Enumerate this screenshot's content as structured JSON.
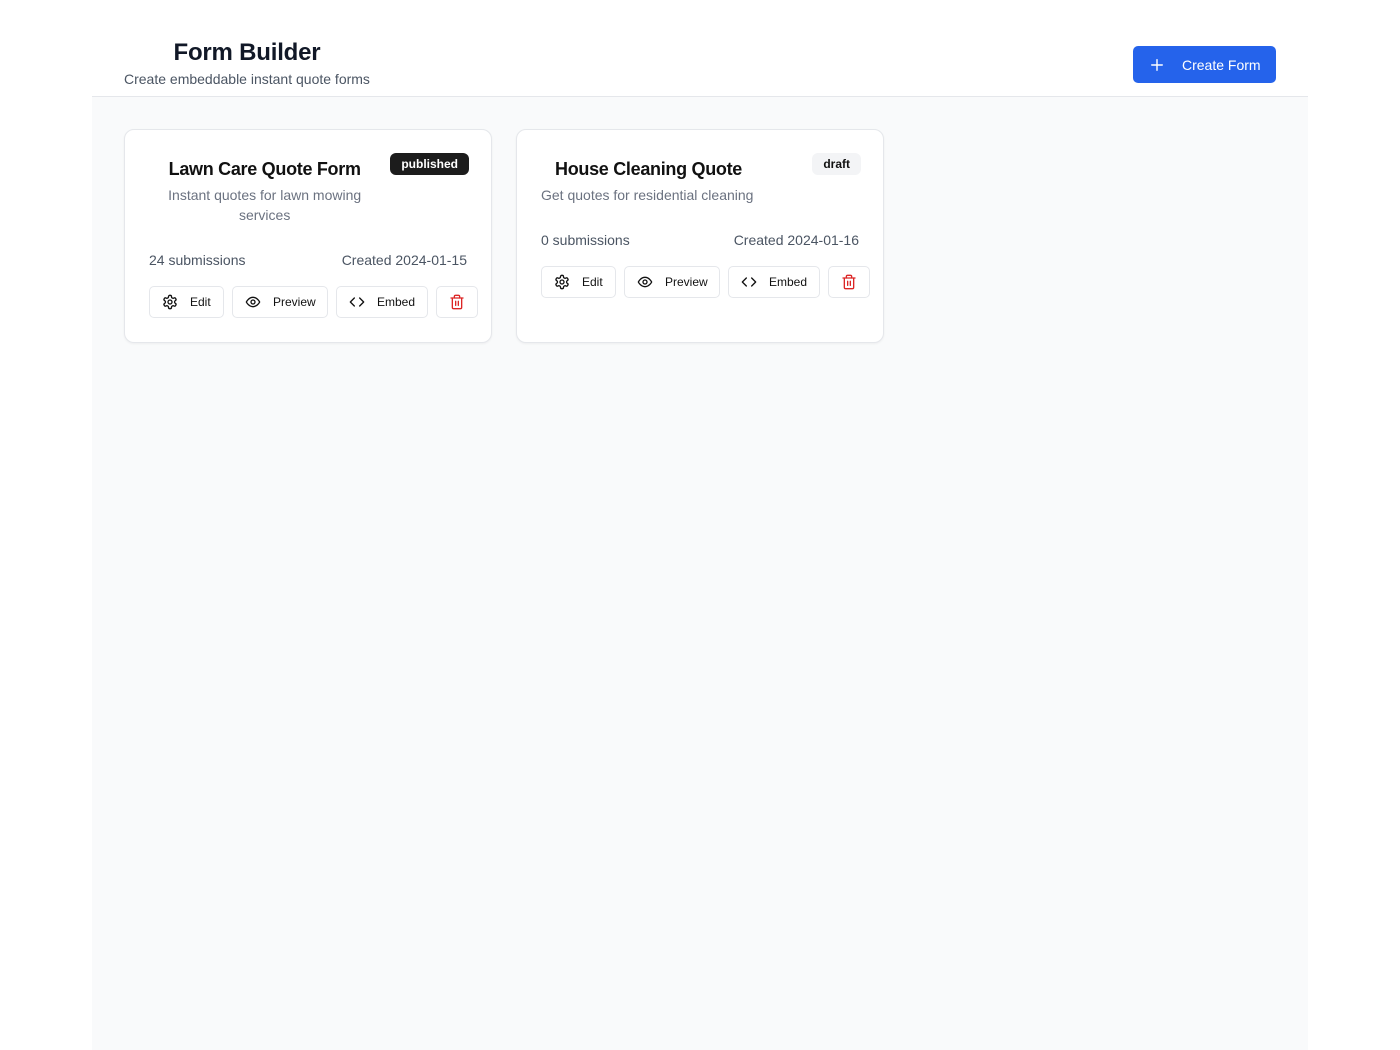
{
  "header": {
    "title": "Form Builder",
    "subtitle": "Create embeddable instant quote forms",
    "create_button_label": "Create Form"
  },
  "forms": [
    {
      "title": "Lawn Care Quote Form",
      "description": "Instant quotes for lawn mowing services",
      "status": "published",
      "submissions": "24 submissions",
      "created": "Created 2024-01-15"
    },
    {
      "title": "House Cleaning Quote",
      "description": "Get quotes for residential cleaning",
      "status": "draft",
      "submissions": "0 submissions",
      "created": "Created 2024-01-16"
    }
  ],
  "actions": {
    "edit_label": "Edit",
    "preview_label": "Preview",
    "embed_label": "Embed"
  },
  "icons": {
    "create": "plus-icon",
    "edit": "gear-icon",
    "preview": "eye-icon",
    "embed": "code-icon",
    "delete": "trash-icon"
  },
  "colors": {
    "primary": "#2563eb",
    "published_badge": "#1c1c1c",
    "draft_badge": "#f3f4f6",
    "danger": "#dc2626",
    "canvas": "#f9fafb"
  }
}
